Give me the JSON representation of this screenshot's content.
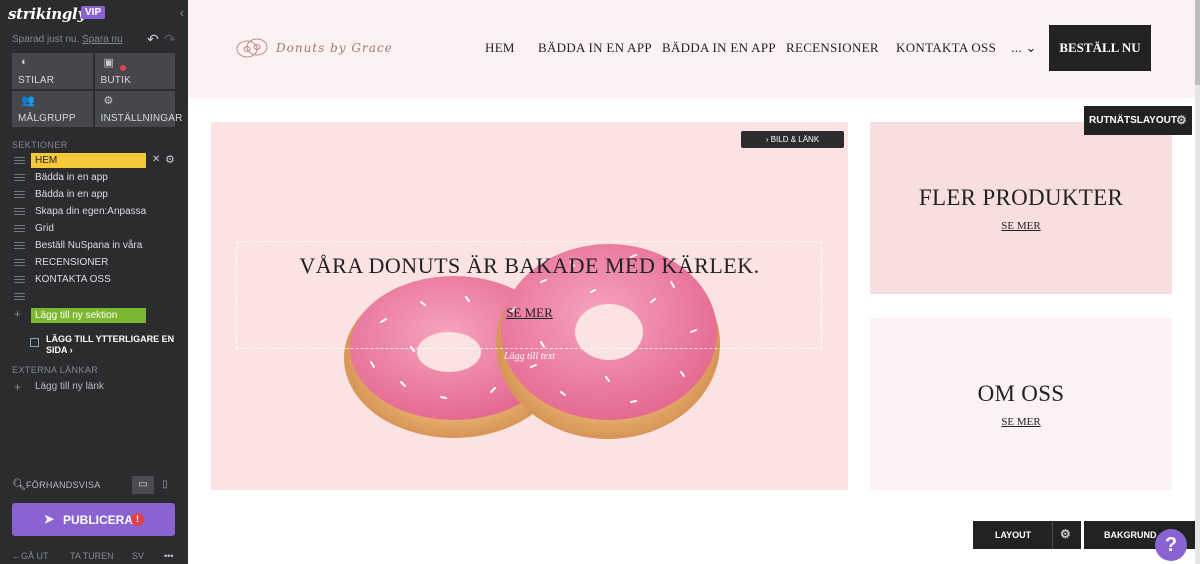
{
  "app": {
    "logo": "strikingly",
    "vip_badge": "VIP",
    "collapse_icon": "chevron-left-icon",
    "saved_text": "Sparad just nu.",
    "save_link": "Spara nu",
    "undo_icon": "undo-icon",
    "redo_icon": "redo-icon"
  },
  "tools": [
    {
      "label": "STILAR",
      "icon": "palette-icon"
    },
    {
      "label": "BUTIK",
      "icon": "shopping-bag-icon",
      "notification": true
    },
    {
      "label": "MÅLGRUPP",
      "icon": "people-icon"
    },
    {
      "label": "INSTÄLLNINGAR",
      "icon": "gear-icon"
    }
  ],
  "sections": {
    "heading": "SEKTIONER",
    "items": [
      {
        "label": "HEM",
        "active": true
      },
      {
        "label": "Bädda in en app"
      },
      {
        "label": "Bädda in en app"
      },
      {
        "label": "Skapa din egen:Anpassa"
      },
      {
        "label": "Grid"
      },
      {
        "label": "Beställ NuSpana in våra"
      },
      {
        "label": "RECENSIONER"
      },
      {
        "label": "KONTAKTA OSS"
      },
      {
        "label": ""
      }
    ],
    "add_section": "Lägg till ny sektion",
    "add_page": "LÄGG TILL YTTERLIGARE EN SIDA"
  },
  "external": {
    "heading": "EXTERNA LÄNKAR",
    "add_link": "Lägg till ny länk"
  },
  "preview": {
    "label": "FÖRHANDSVISA",
    "desktop_icon": "desktop-icon",
    "mobile_icon": "mobile-icon"
  },
  "publish": {
    "label": "PUBLICERA",
    "warning": "!"
  },
  "bottom": {
    "exit": "GÅ UT",
    "tour": "TA TUREN",
    "lang": "SV",
    "more": "•••"
  },
  "site": {
    "brand": "Donuts by Grace",
    "nav": [
      {
        "label": "HEM"
      },
      {
        "label": "BÄDDA IN EN APP"
      },
      {
        "label": "BÄDDA IN EN APP"
      },
      {
        "label": "RECENSIONER"
      },
      {
        "label": "KONTAKTA OSS"
      }
    ],
    "nav_more": "...",
    "cta": "BESTÄLL NU"
  },
  "hero": {
    "title": "VÅRA DONUTS ÄR BAKADE MED KÄRLEK.",
    "link": "SE MER",
    "add_text": "Lägg till text",
    "image_link_btn": "BILD & LÄNK"
  },
  "cards": [
    {
      "title": "FLER PRODUKTER",
      "link": "SE MER"
    },
    {
      "title": "OM OSS",
      "link": "SE MER"
    }
  ],
  "editor": {
    "grid_layout": "RUTNÄTSLAYOUT",
    "layout": "LAYOUT",
    "background": "BAKGRUND",
    "help": "?"
  },
  "colors": {
    "sidebar_bg": "#2b2c2e",
    "vip": "#8a63d2",
    "active_section": "#f6c93a",
    "add_section": "#7cb82f",
    "header_bg": "#fdf2f3",
    "hero_bg": "#fbe3e3",
    "card1_bg": "#f8dfdf"
  }
}
